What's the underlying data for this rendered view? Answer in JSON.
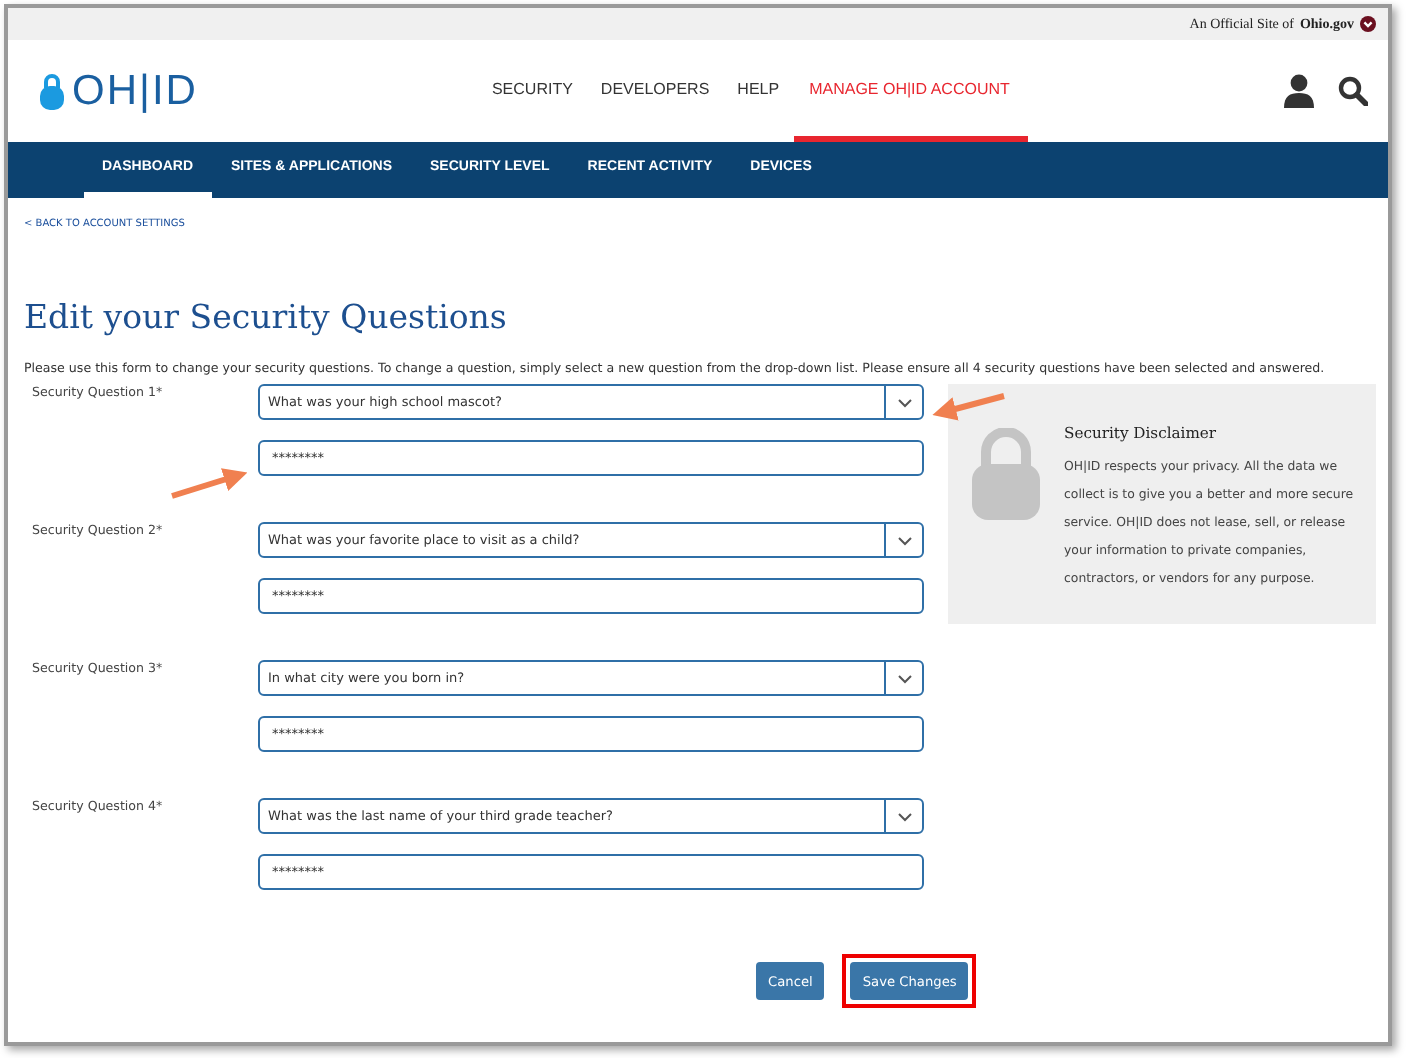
{
  "official_banner": {
    "text": "An Official Site of",
    "brand": "Ohio.gov"
  },
  "logo": {
    "text": "OH|ID"
  },
  "main_nav": [
    {
      "label": "SECURITY",
      "selected": false
    },
    {
      "label": "DEVELOPERS",
      "selected": false
    },
    {
      "label": "HELP",
      "selected": false
    },
    {
      "label": "MANAGE OH|ID ACCOUNT",
      "selected": true
    }
  ],
  "sub_nav": [
    {
      "label": "DASHBOARD",
      "selected": true
    },
    {
      "label": "SITES & APPLICATIONS",
      "selected": false
    },
    {
      "label": "SECURITY LEVEL",
      "selected": false
    },
    {
      "label": "RECENT ACTIVITY",
      "selected": false
    },
    {
      "label": "DEVICES",
      "selected": false
    }
  ],
  "back_link": "< BACK TO ACCOUNT SETTINGS",
  "title": "Edit your Security Questions",
  "intro": "Please use this form to change your security questions. To change a question, simply select a new question from the drop-down list. Please ensure all 4 security questions have been selected and answered.",
  "questions": [
    {
      "label": "Security Question 1*",
      "question": "What was your high school mascot?",
      "answer": "********"
    },
    {
      "label": "Security Question 2*",
      "question": "What was your favorite place to visit as a child?",
      "answer": "********"
    },
    {
      "label": "Security Question 3*",
      "question": "In what city were you born in?",
      "answer": "********"
    },
    {
      "label": "Security Question 4*",
      "question": "What was the last name of your third grade teacher?",
      "answer": "********"
    }
  ],
  "disclaimer": {
    "title": "Security Disclaimer",
    "text": "OH|ID respects your privacy. All the data we collect is to give you a better and more secure service. OH|ID does not lease, sell, or release your information to private companies, contractors, or vendors for any purpose."
  },
  "buttons": [
    {
      "label": "Cancel",
      "highlighted": false
    },
    {
      "label": "Save Changes",
      "highlighted": true
    }
  ]
}
